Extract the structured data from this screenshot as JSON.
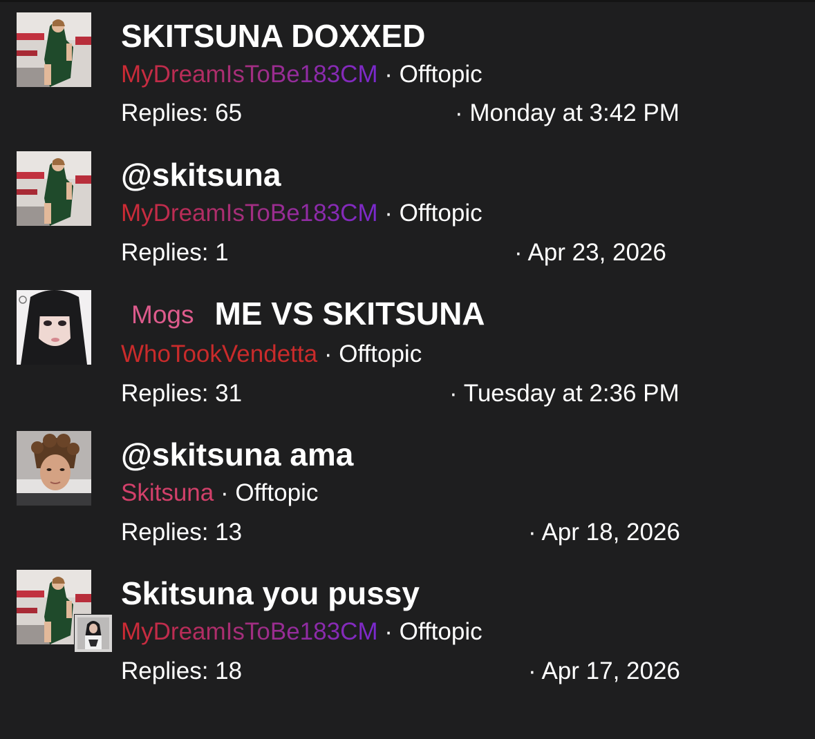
{
  "threads": [
    {
      "title": "SKITSUNA DOXXED",
      "prefix": "",
      "author": "MyDreamIsToBe183CM",
      "forum": "Offtopic",
      "replies": "Replies: 65",
      "date": "Monday at 3:42 PM",
      "avatar": "gym-athlete-photo"
    },
    {
      "title": "@skitsuna",
      "prefix": "",
      "author": "MyDreamIsToBe183CM",
      "forum": "Offtopic",
      "replies": "Replies: 1",
      "date": "Apr 23, 2026",
      "avatar": "gym-athlete-photo"
    },
    {
      "title": "ME VS SKITSUNA",
      "prefix": "Mogs",
      "author": "WhoTookVendetta",
      "forum": "Offtopic",
      "replies": "Replies: 31",
      "date": "Tuesday at 2:36 PM",
      "avatar": "anime-girl-photo"
    },
    {
      "title": "@skitsuna ama",
      "prefix": "",
      "author": "Skitsuna",
      "forum": "Offtopic",
      "replies": "Replies: 13",
      "date": "Apr 18, 2026",
      "avatar": "curly-hair-selfie"
    },
    {
      "title": "Skitsuna you pussy",
      "prefix": "",
      "author": "MyDreamIsToBe183CM",
      "forum": "Offtopic",
      "replies": "Replies: 18",
      "date": "Apr 17, 2026",
      "avatar": "gym-athlete-photo",
      "secondary_avatar": "mirror-selfie-photo"
    }
  ],
  "separator": "·",
  "colors": {
    "background": "#1e1e1f",
    "prefix_mogs": "#dd5b8c",
    "username_gradient_start": "#cf2b32",
    "username_gradient_end": "#7a29cf",
    "username_red": "#c92b2b",
    "username_pink": "#d2406a"
  }
}
